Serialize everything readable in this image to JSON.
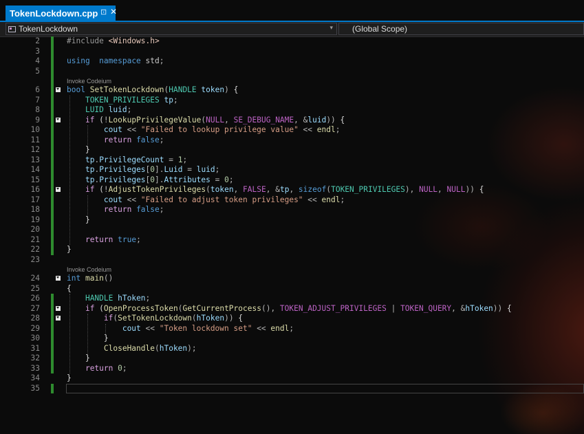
{
  "tab": {
    "title": "TokenLockdown.cpp",
    "pin_icon": "⊡",
    "close_icon": "✕"
  },
  "navbar": {
    "project": "TokenLockdown",
    "scope": "(Global Scope)",
    "dropdown_icon": "▾"
  },
  "codelens": {
    "label": "Invoke Codeium"
  },
  "lines": [
    {
      "n": "2",
      "tokens": [
        [
          "pp",
          "#include "
        ],
        [
          "inc",
          "<Windows.h>"
        ]
      ]
    },
    {
      "n": "3",
      "tokens": []
    },
    {
      "n": "4",
      "tokens": [
        [
          "kw",
          "using"
        ],
        [
          "",
          "  "
        ],
        [
          "kw",
          "namespace"
        ],
        [
          "",
          ""
        ],
        [
          "ns",
          " std"
        ],
        [
          "op",
          ";"
        ]
      ]
    },
    {
      "n": "5",
      "tokens": []
    },
    {
      "n": "6",
      "fold": true,
      "tokens": [
        [
          "kw",
          "bool"
        ],
        [
          "",
          " "
        ],
        [
          "fn",
          "SetTokenLockdown"
        ],
        [
          "op",
          "("
        ],
        [
          "ty",
          "HANDLE"
        ],
        [
          "",
          " "
        ],
        [
          "var",
          "token"
        ],
        [
          "op",
          ")"
        ],
        [
          "",
          " {"
        ]
      ]
    },
    {
      "n": "7",
      "tokens": [
        [
          "",
          "    "
        ],
        [
          "ty",
          "TOKEN_PRIVILEGES"
        ],
        [
          "",
          " "
        ],
        [
          "var",
          "tp"
        ],
        [
          "op",
          ";"
        ]
      ]
    },
    {
      "n": "8",
      "tokens": [
        [
          "",
          "    "
        ],
        [
          "ty",
          "LUID"
        ],
        [
          "",
          " "
        ],
        [
          "var",
          "luid"
        ],
        [
          "op",
          ";"
        ]
      ]
    },
    {
      "n": "9",
      "fold": true,
      "tokens": [
        [
          "",
          "    "
        ],
        [
          "ctl",
          "if"
        ],
        [
          "",
          " ("
        ],
        [
          "op",
          "!"
        ],
        [
          "fn",
          "LookupPrivilegeValue"
        ],
        [
          "op",
          "("
        ],
        [
          "mac",
          "NULL"
        ],
        [
          "op",
          ", "
        ],
        [
          "mac",
          "SE_DEBUG_NAME"
        ],
        [
          "op",
          ", &"
        ],
        [
          "var",
          "luid"
        ],
        [
          "op",
          "))"
        ],
        [
          "",
          " {"
        ]
      ]
    },
    {
      "n": "10",
      "tokens": [
        [
          "",
          "        "
        ],
        [
          "var",
          "cout"
        ],
        [
          "op",
          " << "
        ],
        [
          "str",
          "\"Failed to lookup privilege value\""
        ],
        [
          "op",
          " << "
        ],
        [
          "fn",
          "endl"
        ],
        [
          "op",
          ";"
        ]
      ]
    },
    {
      "n": "11",
      "tokens": [
        [
          "",
          "        "
        ],
        [
          "ctl",
          "return"
        ],
        [
          "",
          " "
        ],
        [
          "kw",
          "false"
        ],
        [
          "op",
          ";"
        ]
      ]
    },
    {
      "n": "12",
      "tokens": [
        [
          "",
          "    }"
        ]
      ]
    },
    {
      "n": "13",
      "tokens": [
        [
          "",
          "    "
        ],
        [
          "var",
          "tp"
        ],
        [
          "op",
          "."
        ],
        [
          "var",
          "PrivilegeCount"
        ],
        [
          "op",
          " = "
        ],
        [
          "num",
          "1"
        ],
        [
          "op",
          ";"
        ]
      ]
    },
    {
      "n": "14",
      "tokens": [
        [
          "",
          "    "
        ],
        [
          "var",
          "tp"
        ],
        [
          "op",
          "."
        ],
        [
          "var",
          "Privileges"
        ],
        [
          "op",
          "["
        ],
        [
          "num",
          "0"
        ],
        [
          "op",
          "]."
        ],
        [
          "var",
          "Luid"
        ],
        [
          "op",
          " = "
        ],
        [
          "var",
          "luid"
        ],
        [
          "op",
          ";"
        ]
      ]
    },
    {
      "n": "15",
      "tokens": [
        [
          "",
          "    "
        ],
        [
          "var",
          "tp"
        ],
        [
          "op",
          "."
        ],
        [
          "var",
          "Privileges"
        ],
        [
          "op",
          "["
        ],
        [
          "num",
          "0"
        ],
        [
          "op",
          "]."
        ],
        [
          "var",
          "Attributes"
        ],
        [
          "op",
          " = "
        ],
        [
          "num",
          "0"
        ],
        [
          "op",
          ";"
        ]
      ]
    },
    {
      "n": "16",
      "fold": true,
      "tokens": [
        [
          "",
          "    "
        ],
        [
          "ctl",
          "if"
        ],
        [
          "",
          " ("
        ],
        [
          "op",
          "!"
        ],
        [
          "fn",
          "AdjustTokenPrivileges"
        ],
        [
          "op",
          "("
        ],
        [
          "var",
          "token"
        ],
        [
          "op",
          ", "
        ],
        [
          "mac",
          "FALSE"
        ],
        [
          "op",
          ", &"
        ],
        [
          "var",
          "tp"
        ],
        [
          "op",
          ", "
        ],
        [
          "kw",
          "sizeof"
        ],
        [
          "op",
          "("
        ],
        [
          "ty",
          "TOKEN_PRIVILEGES"
        ],
        [
          "op",
          "), "
        ],
        [
          "mac",
          "NULL"
        ],
        [
          "op",
          ", "
        ],
        [
          "mac",
          "NULL"
        ],
        [
          "op",
          "))"
        ],
        [
          "",
          " {"
        ]
      ]
    },
    {
      "n": "17",
      "tokens": [
        [
          "",
          "        "
        ],
        [
          "var",
          "cout"
        ],
        [
          "op",
          " << "
        ],
        [
          "str",
          "\"Failed to adjust token privileges\""
        ],
        [
          "op",
          " << "
        ],
        [
          "fn",
          "endl"
        ],
        [
          "op",
          ";"
        ]
      ]
    },
    {
      "n": "18",
      "tokens": [
        [
          "",
          "        "
        ],
        [
          "ctl",
          "return"
        ],
        [
          "",
          " "
        ],
        [
          "kw",
          "false"
        ],
        [
          "op",
          ";"
        ]
      ]
    },
    {
      "n": "19",
      "tokens": [
        [
          "",
          "    }"
        ]
      ]
    },
    {
      "n": "20",
      "tokens": []
    },
    {
      "n": "21",
      "tokens": [
        [
          "",
          "    "
        ],
        [
          "ctl",
          "return"
        ],
        [
          "",
          " "
        ],
        [
          "kw",
          "true"
        ],
        [
          "op",
          ";"
        ]
      ]
    },
    {
      "n": "22",
      "tokens": [
        [
          "",
          "}"
        ]
      ]
    },
    {
      "n": "23",
      "tokens": []
    },
    {
      "n": "24",
      "fold": true,
      "tokens": [
        [
          "kw",
          "int"
        ],
        [
          "",
          " "
        ],
        [
          "fn",
          "main"
        ],
        [
          "op",
          "()"
        ]
      ]
    },
    {
      "n": "25",
      "tokens": [
        [
          "",
          "{"
        ]
      ]
    },
    {
      "n": "26",
      "tokens": [
        [
          "",
          "    "
        ],
        [
          "ty",
          "HANDLE"
        ],
        [
          "",
          " "
        ],
        [
          "var",
          "hToken"
        ],
        [
          "op",
          ";"
        ]
      ]
    },
    {
      "n": "27",
      "fold": true,
      "tokens": [
        [
          "",
          "    "
        ],
        [
          "ctl",
          "if"
        ],
        [
          "",
          " ("
        ],
        [
          "fn",
          "OpenProcessToken"
        ],
        [
          "op",
          "("
        ],
        [
          "fn",
          "GetCurrentProcess"
        ],
        [
          "op",
          "(), "
        ],
        [
          "mac",
          "TOKEN_ADJUST_PRIVILEGES"
        ],
        [
          "op",
          " | "
        ],
        [
          "mac",
          "TOKEN_QUERY"
        ],
        [
          "op",
          ", &"
        ],
        [
          "var",
          "hToken"
        ],
        [
          "op",
          "))"
        ],
        [
          "",
          " {"
        ]
      ]
    },
    {
      "n": "28",
      "fold": true,
      "tokens": [
        [
          "",
          "        "
        ],
        [
          "ctl",
          "if"
        ],
        [
          "op",
          "("
        ],
        [
          "fn",
          "SetTokenLockdown"
        ],
        [
          "op",
          "("
        ],
        [
          "var",
          "hToken"
        ],
        [
          "op",
          "))"
        ],
        [
          "",
          " {"
        ]
      ]
    },
    {
      "n": "29",
      "tokens": [
        [
          "",
          "            "
        ],
        [
          "var",
          "cout"
        ],
        [
          "op",
          " << "
        ],
        [
          "str",
          "\"Token lockdown set\""
        ],
        [
          "op",
          " << "
        ],
        [
          "fn",
          "endl"
        ],
        [
          "op",
          ";"
        ]
      ]
    },
    {
      "n": "30",
      "tokens": [
        [
          "",
          "        }"
        ]
      ]
    },
    {
      "n": "31",
      "tokens": [
        [
          "",
          "        "
        ],
        [
          "fn",
          "CloseHandle"
        ],
        [
          "op",
          "("
        ],
        [
          "var",
          "hToken"
        ],
        [
          "op",
          ");"
        ]
      ]
    },
    {
      "n": "32",
      "tokens": [
        [
          "",
          "    }"
        ]
      ]
    },
    {
      "n": "33",
      "tokens": [
        [
          "",
          "    "
        ],
        [
          "ctl",
          "return"
        ],
        [
          "",
          " "
        ],
        [
          "num",
          "0"
        ],
        [
          "op",
          ";"
        ]
      ]
    },
    {
      "n": "34",
      "tokens": [
        [
          "",
          "}"
        ]
      ]
    },
    {
      "n": "35",
      "tokens": []
    }
  ]
}
